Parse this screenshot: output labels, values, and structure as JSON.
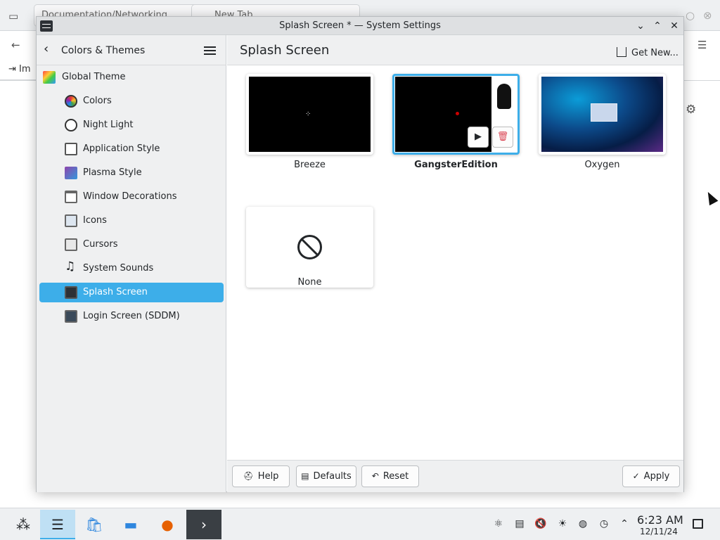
{
  "background": {
    "tabs": [
      "Documentation/Networking",
      "New Tab"
    ],
    "bookmark": "Im"
  },
  "window": {
    "title": "Splash Screen * — System Settings"
  },
  "sidebar": {
    "back_title": "Colors & Themes",
    "items": [
      {
        "label": "Global Theme",
        "icon": "global-theme-icon"
      },
      {
        "label": "Colors",
        "icon": "colors-icon"
      },
      {
        "label": "Night Light",
        "icon": "night-light-icon"
      },
      {
        "label": "Application Style",
        "icon": "application-style-icon"
      },
      {
        "label": "Plasma Style",
        "icon": "plasma-style-icon"
      },
      {
        "label": "Window Decorations",
        "icon": "window-decorations-icon"
      },
      {
        "label": "Icons",
        "icon": "icons-icon"
      },
      {
        "label": "Cursors",
        "icon": "cursors-icon"
      },
      {
        "label": "System Sounds",
        "icon": "music-note-icon"
      },
      {
        "label": "Splash Screen",
        "icon": "splash-screen-icon",
        "selected": true
      },
      {
        "label": "Login Screen (SDDM)",
        "icon": "login-screen-icon"
      }
    ]
  },
  "main": {
    "title": "Splash Screen",
    "get_new": "Get New...",
    "themes": [
      {
        "name": "Breeze"
      },
      {
        "name": "GangsterEdition",
        "selected": true
      },
      {
        "name": "Oxygen"
      },
      {
        "name": "None"
      }
    ]
  },
  "footer": {
    "help": "Help",
    "defaults": "Defaults",
    "reset": "Reset",
    "apply": "Apply"
  },
  "taskbar": {
    "time": "6:23 AM",
    "date": "12/11/24"
  },
  "colors": {
    "accent": "#3daee9",
    "delete": "#da4453"
  }
}
